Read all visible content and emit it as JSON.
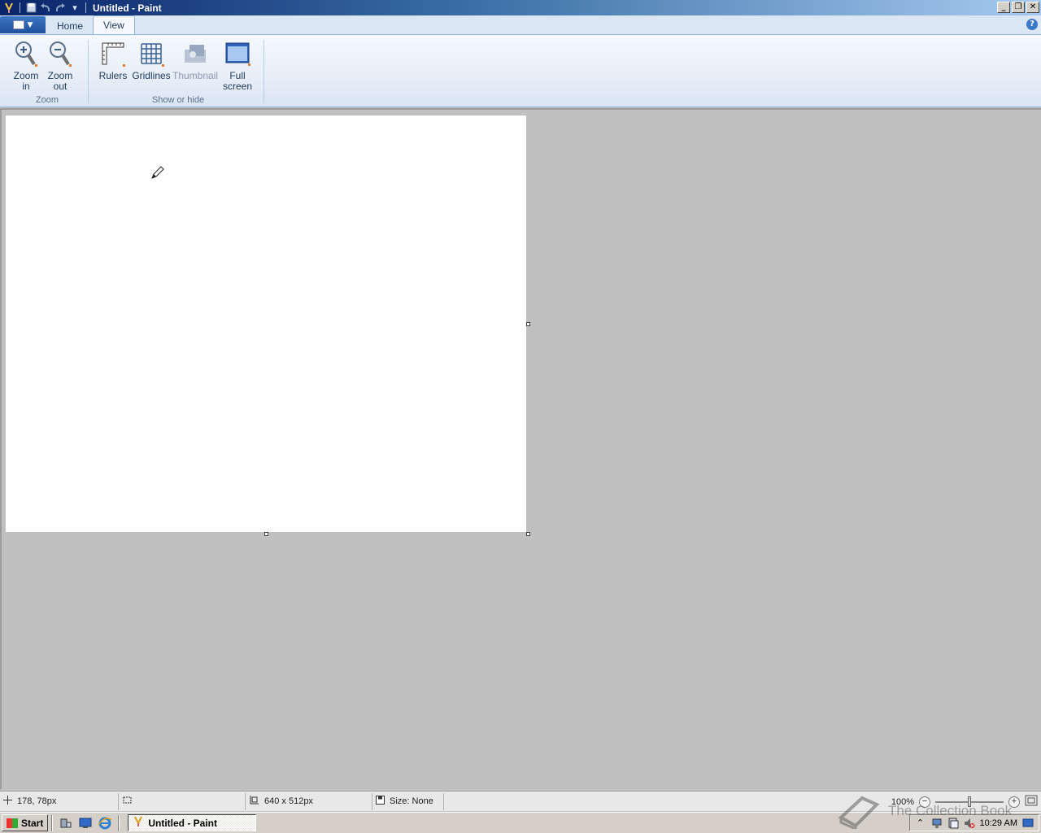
{
  "window": {
    "title": "Untitled - Paint",
    "controls": [
      "_",
      "❐",
      "✕"
    ]
  },
  "quick_access": {
    "icons": [
      "paint-app-icon",
      "save-icon",
      "undo-icon",
      "redo-icon",
      "customize-dropdown-icon"
    ]
  },
  "ribbon": {
    "tabs": [
      {
        "label": "Home",
        "active": false
      },
      {
        "label": "View",
        "active": true
      }
    ],
    "help_label": "?",
    "groups": {
      "zoom": {
        "label": "Zoom",
        "zoom_in": "Zoom\nin",
        "zoom_out": "Zoom\nout"
      },
      "show_hide": {
        "label": "Show or hide",
        "rulers": "Rulers",
        "gridlines": "Gridlines",
        "thumbnail": "Thumbnail",
        "full_screen": "Full\nscreen"
      }
    }
  },
  "status": {
    "cursor_pos": "178, 78px",
    "selection": "",
    "canvas_size": "640 x 512px",
    "file_size": "Size: None",
    "zoom": "100%"
  },
  "taskbar": {
    "start_label": "Start",
    "task_label": "Untitled - Paint",
    "clock": "10:29 AM"
  },
  "watermark": {
    "text": "The Collection Book"
  },
  "colors": {
    "title_start": "#0a246a",
    "title_end": "#a6caf0",
    "workspace": "#c0c0c0",
    "canvas": "#ffffff",
    "ribbon_text": "#1e395b"
  }
}
